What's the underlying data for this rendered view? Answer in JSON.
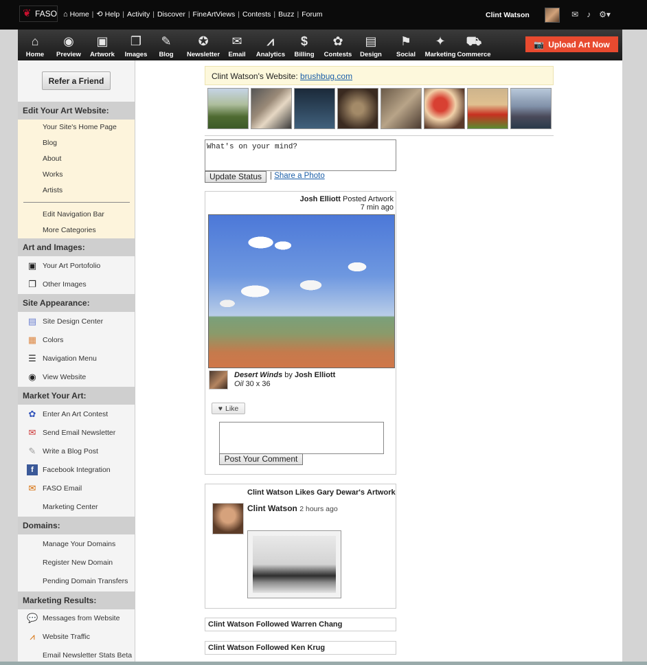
{
  "topbar": {
    "logo": "FASO",
    "nav": [
      {
        "label": "Home",
        "icon": "home-icon"
      },
      {
        "label": "Help",
        "icon": "help-icon"
      },
      {
        "label": "Activity"
      },
      {
        "label": "Discover"
      },
      {
        "label": "FineArtViews"
      },
      {
        "label": "Contests"
      },
      {
        "label": "Buzz"
      },
      {
        "label": "Forum"
      }
    ],
    "user_name": "Clint Watson"
  },
  "toolbar": {
    "items": [
      {
        "label": "Home",
        "glyph": "⌂",
        "icon": "home-icon"
      },
      {
        "label": "Preview",
        "glyph": "◉",
        "icon": "eye-icon"
      },
      {
        "label": "Artwork",
        "glyph": "▣",
        "icon": "easel-icon"
      },
      {
        "label": "Images",
        "glyph": "❐",
        "icon": "images-icon"
      },
      {
        "label": "Blog",
        "glyph": "✎",
        "icon": "quill-icon"
      },
      {
        "label": "Newsletter",
        "glyph": "✪",
        "icon": "newsletter-icon"
      },
      {
        "label": "Email",
        "glyph": "✉",
        "icon": "email-icon"
      },
      {
        "label": "Analytics",
        "glyph": "⩘",
        "icon": "chart-icon"
      },
      {
        "label": "Billing",
        "glyph": "$",
        "icon": "dollar-icon"
      },
      {
        "label": "Contests",
        "glyph": "✿",
        "icon": "ribbon-icon"
      },
      {
        "label": "Design",
        "glyph": "▤",
        "icon": "design-icon"
      },
      {
        "label": "Social",
        "glyph": "⚑",
        "icon": "social-icon"
      },
      {
        "label": "Marketing",
        "glyph": "✦",
        "icon": "tag-icon"
      },
      {
        "label": "Commerce",
        "glyph": "⛟",
        "icon": "cart-icon"
      }
    ],
    "upload_label": "Upload Art Now"
  },
  "sidebar": {
    "refer_label": "Refer a Friend",
    "sections": [
      {
        "title": "Edit Your Art Website:",
        "items": [
          "Your Site's Home Page",
          "Blog",
          "About",
          "Works",
          "Artists"
        ],
        "items2": [
          "Edit Navigation Bar",
          "More Categories"
        ]
      },
      {
        "title": "Art and Images:",
        "items": [
          "Your Art Portofolio",
          "Other Images"
        ]
      },
      {
        "title": "Site Appearance:",
        "items": [
          "Site Design Center",
          "Colors",
          "Navigation Menu",
          "View Website"
        ]
      },
      {
        "title": "Market Your Art:",
        "items": [
          "Enter An Art Contest",
          "Send Email Newsletter",
          "Write a Blog Post",
          "Facebook Integration",
          "FASO Email",
          "Marketing Center"
        ]
      },
      {
        "title": "Domains:",
        "items": [
          "Manage Your Domains",
          "Register New Domain",
          "Pending Domain Transfers"
        ]
      },
      {
        "title": "Marketing Results:",
        "items": [
          "Messages from Website",
          "Website Traffic",
          "Email Newsletter Stats Beta"
        ]
      }
    ]
  },
  "main": {
    "site_prefix": "Clint Watson's Website:",
    "site_link": "brushbug.com",
    "status_placeholder": "What's on your mind?",
    "update_label": "Update Status",
    "share_sep": "|",
    "share_label": "Share a Photo",
    "post1": {
      "author": "Josh Elliott",
      "action": "Posted Artwork",
      "time": "7 min ago",
      "title": "Desert Winds",
      "by": "by",
      "artist": "Josh Elliott",
      "medium": "Oil",
      "size": "30 x 36",
      "like_label": "Like",
      "comment_label": "Post Your Comment"
    },
    "post2": {
      "headline_user": "Clint Watson",
      "headline_action": "Likes",
      "headline_target": "Gary Dewar's",
      "headline_object": "Artwork",
      "author": "Clint Watson",
      "time": "2 hours ago"
    },
    "follows": [
      {
        "user": "Clint Watson",
        "action": "Followed",
        "target": "Warren Chang"
      },
      {
        "user": "Clint Watson",
        "action": "Followed",
        "target": "Ken Krug"
      }
    ]
  }
}
